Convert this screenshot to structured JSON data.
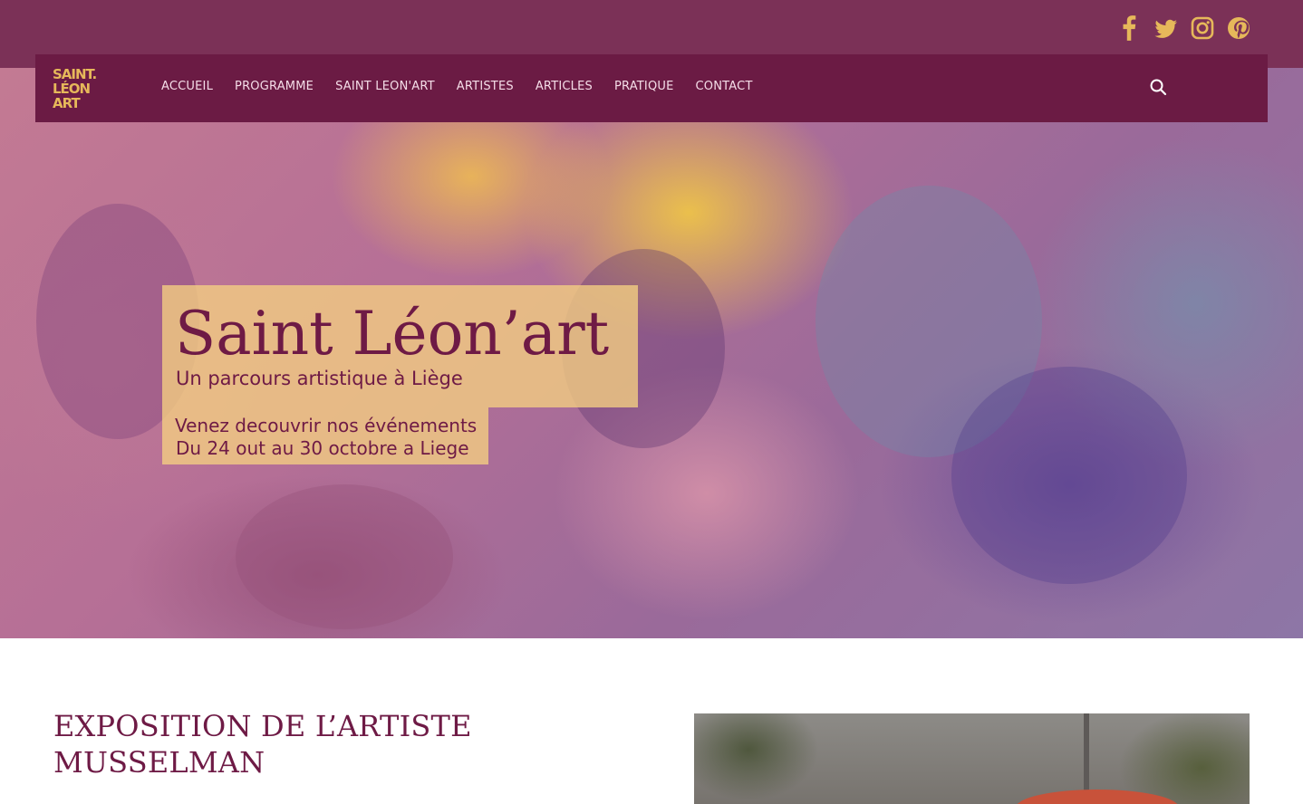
{
  "social": {
    "icons": [
      "facebook-icon",
      "twitter-icon",
      "instagram-icon",
      "pinterest-icon"
    ],
    "color": "#e6b85a"
  },
  "nav": {
    "logo_lines": [
      "SAINT.",
      "LÉON",
      "ART"
    ],
    "items": [
      "ACCUEIL",
      "PROGRAMME",
      "SAINT LEON'ART",
      "ARTISTES",
      "ARTICLES",
      "PRATIQUE",
      "CONTACT"
    ],
    "search_icon": "search-icon"
  },
  "hero": {
    "title": "Saint Léon’art",
    "subtitle": "Un parcours artistique à Liège",
    "event_line1": "Venez decouvrir nos événements",
    "event_line2": "Du 24 out au 30 octobre a Liege"
  },
  "article": {
    "title": "EXPOSITION DE L’ARTISTE MUSSELMAN"
  },
  "colors": {
    "topbar": "#7b3157",
    "navbar": "#6b1b44",
    "accent": "#e6b85a",
    "text_primary": "#6e1a45"
  }
}
